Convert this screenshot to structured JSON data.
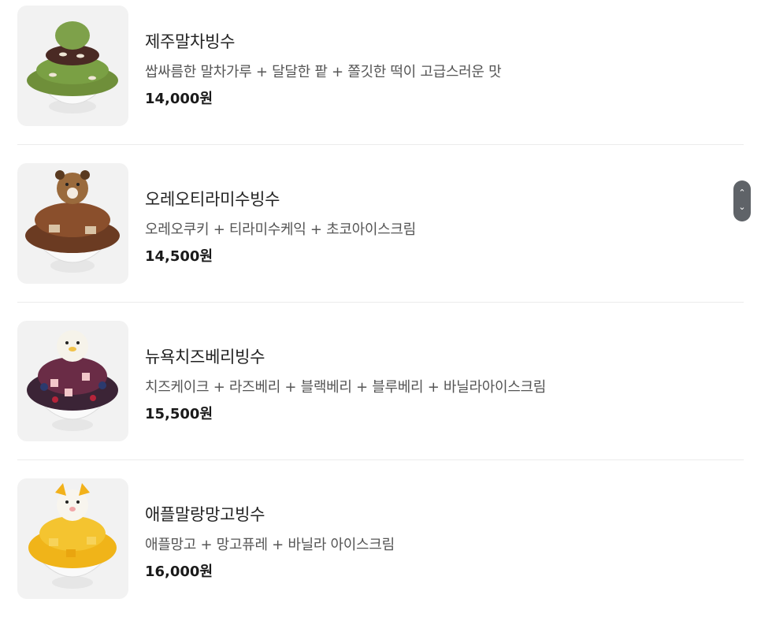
{
  "menu": {
    "items": [
      {
        "name": "제주말차빙수",
        "description": "쌉싸름한 말차가루 + 달달한 팥 + 쫄깃한 떡이 고급스러운 맛",
        "price": "14,000원",
        "image_icon": "matcha-bingsu-icon"
      },
      {
        "name": "오레오티라미수빙수",
        "description": "오레오쿠키 + 티라미수케익 + 초코아이스크림",
        "price": "14,500원",
        "image_icon": "oreo-tiramisu-bingsu-icon"
      },
      {
        "name": "뉴욕치즈베리빙수",
        "description": "치즈케이크 + 라즈베리 + 블랙베리 + 블루베리 + 바닐라아이스크림",
        "price": "15,500원",
        "image_icon": "cheese-berry-bingsu-icon"
      },
      {
        "name": "애플말랑망고빙수",
        "description": "애플망고 + 망고퓨레 + 바닐라 아이스크림",
        "price": "16,000원",
        "image_icon": "mango-bingsu-icon"
      }
    ]
  },
  "scrollbar": {
    "up_icon": "⌃",
    "down_icon": "⌄"
  },
  "colors": {
    "thumb_bg": "#f2f2f2",
    "divider": "#ececec",
    "scroll_handle": "#5f6368"
  }
}
